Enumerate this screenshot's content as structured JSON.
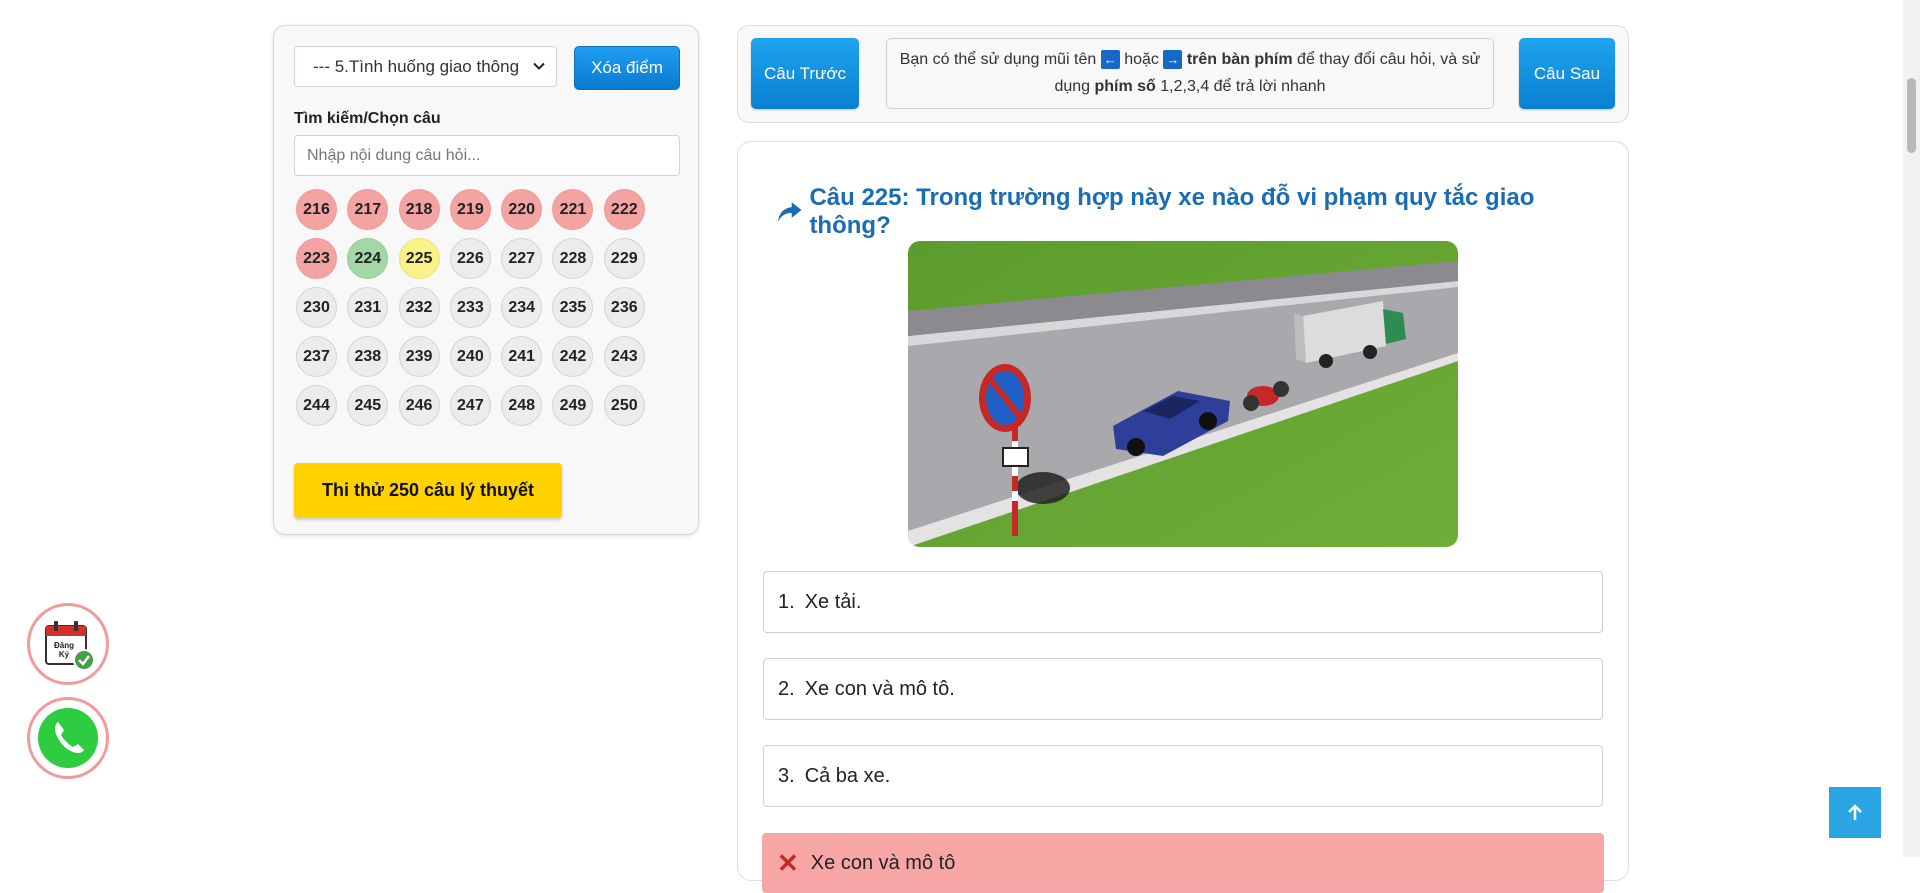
{
  "sidebar": {
    "topic_select": "--- 5.Tình huống giao thông",
    "clear_button": "Xóa điểm",
    "search_label": "Tìm kiếm/Chọn câu",
    "search_placeholder": "Nhập nội dung câu hỏi...",
    "questions": [
      {
        "n": "216",
        "s": "wrong"
      },
      {
        "n": "217",
        "s": "wrong"
      },
      {
        "n": "218",
        "s": "wrong"
      },
      {
        "n": "219",
        "s": "wrong"
      },
      {
        "n": "220",
        "s": "wrong"
      },
      {
        "n": "221",
        "s": "wrong"
      },
      {
        "n": "222",
        "s": "wrong"
      },
      {
        "n": "223",
        "s": "wrong"
      },
      {
        "n": "224",
        "s": "right"
      },
      {
        "n": "225",
        "s": "current"
      },
      {
        "n": "226",
        "s": ""
      },
      {
        "n": "227",
        "s": ""
      },
      {
        "n": "228",
        "s": ""
      },
      {
        "n": "229",
        "s": ""
      },
      {
        "n": "230",
        "s": ""
      },
      {
        "n": "231",
        "s": ""
      },
      {
        "n": "232",
        "s": ""
      },
      {
        "n": "233",
        "s": ""
      },
      {
        "n": "234",
        "s": ""
      },
      {
        "n": "235",
        "s": ""
      },
      {
        "n": "236",
        "s": ""
      },
      {
        "n": "237",
        "s": ""
      },
      {
        "n": "238",
        "s": ""
      },
      {
        "n": "239",
        "s": ""
      },
      {
        "n": "240",
        "s": ""
      },
      {
        "n": "241",
        "s": ""
      },
      {
        "n": "242",
        "s": ""
      },
      {
        "n": "243",
        "s": ""
      },
      {
        "n": "244",
        "s": ""
      },
      {
        "n": "245",
        "s": ""
      },
      {
        "n": "246",
        "s": ""
      },
      {
        "n": "247",
        "s": ""
      },
      {
        "n": "248",
        "s": ""
      },
      {
        "n": "249",
        "s": ""
      },
      {
        "n": "250",
        "s": ""
      }
    ],
    "exam_button": "Thi thử 250 câu lý thuyết"
  },
  "nav": {
    "prev_label": "Câu Trước",
    "next_label": "Câu Sau",
    "hint_part1": "Bạn có thể sử dụng mũi tên",
    "hint_part2": "hoặc",
    "hint_bold1": "trên bàn phím",
    "hint_part3": "để thay đổi câu hỏi, và sử dụng",
    "hint_bold2": "phím số",
    "hint_part4": "1,2,3,4 để trả lời nhanh"
  },
  "question": {
    "title": "Câu 225: Trong trường hợp này xe nào đỗ vi phạm quy tắc giao thông?",
    "answers": [
      {
        "num": "1.",
        "text": "Xe tải."
      },
      {
        "num": "2.",
        "text": "Xe con và mô tô."
      },
      {
        "num": "3.",
        "text": "Cả ba xe."
      }
    ],
    "result_text": "Xe con và mô tô"
  },
  "floating": {
    "register_text1": "Đăng",
    "register_text2": "Ký"
  },
  "colors": {
    "accent": "#0b79cf",
    "title": "#1a6cb4",
    "wrong": "#f4a3a3",
    "right": "#a5d6a7",
    "current": "#f8f289",
    "exam": "#ffd200"
  }
}
